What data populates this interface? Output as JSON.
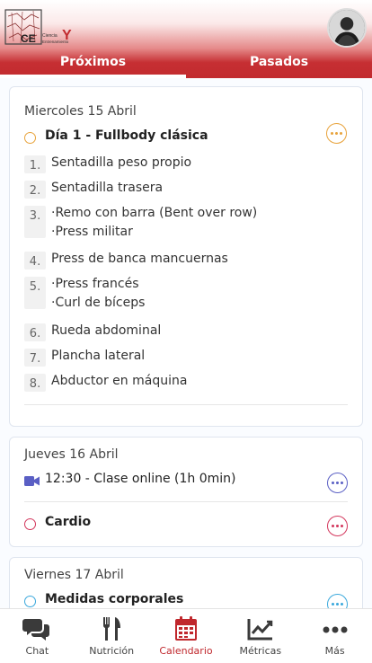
{
  "header": {
    "logo_letters": "CE",
    "logo_y": "Y",
    "logo_sub1": "Ciencia",
    "logo_sub2": "Entrenamiento",
    "tabs": [
      {
        "label": "Próximos",
        "active": true
      },
      {
        "label": "Pasados",
        "active": false
      }
    ]
  },
  "colors": {
    "brand_red": "#c22a2e",
    "orange": "#e8a33c",
    "indigo": "#5a5fc4",
    "pink": "#d3365c",
    "cyan": "#3aa8dc"
  },
  "days": [
    {
      "date": "Miercoles 15 Abril",
      "events": [
        {
          "title": "Día 1 - Fullbody clásica",
          "ring_color": "#e8a33c",
          "more_icon": "more-dots-icon",
          "exercises": [
            {
              "num": "1.",
              "lines": [
                "Sentadilla peso propio"
              ]
            },
            {
              "num": "2.",
              "lines": [
                "Sentadilla trasera"
              ]
            },
            {
              "num": "3.",
              "lines": [
                "·Remo con barra (Bent over row)",
                "·Press militar"
              ]
            },
            {
              "num": "4.",
              "lines": [
                "Press de banca mancuernas"
              ]
            },
            {
              "num": "5.",
              "lines": [
                "·Press francés",
                "·Curl de bíceps"
              ]
            },
            {
              "num": "6.",
              "lines": [
                "Rueda abdominal"
              ]
            },
            {
              "num": "7.",
              "lines": [
                "Plancha lateral"
              ]
            },
            {
              "num": "8.",
              "lines": [
                "Abductor en máquina"
              ]
            }
          ]
        }
      ]
    },
    {
      "date": "Jueves 16 Abril",
      "events": [
        {
          "title": "12:30 - Clase online (1h 0min)",
          "icon": "video-camera-icon",
          "ring_color": "#5a5fc4"
        },
        {
          "title": "Cardio",
          "ring_color": "#d3365c"
        }
      ]
    },
    {
      "date": "Viernes 17 Abril",
      "events": [
        {
          "title": "Medidas corporales",
          "ring_color": "#3aa8dc"
        }
      ]
    }
  ],
  "nav": [
    {
      "label": "Chat",
      "icon": "chat-bubbles-icon",
      "active": false
    },
    {
      "label": "Nutrición",
      "icon": "fork-knife-icon",
      "active": false
    },
    {
      "label": "Calendario",
      "icon": "calendar-icon",
      "active": true
    },
    {
      "label": "Métricas",
      "icon": "chart-line-icon",
      "active": false
    },
    {
      "label": "Más",
      "icon": "more-dots-icon",
      "active": false
    }
  ]
}
